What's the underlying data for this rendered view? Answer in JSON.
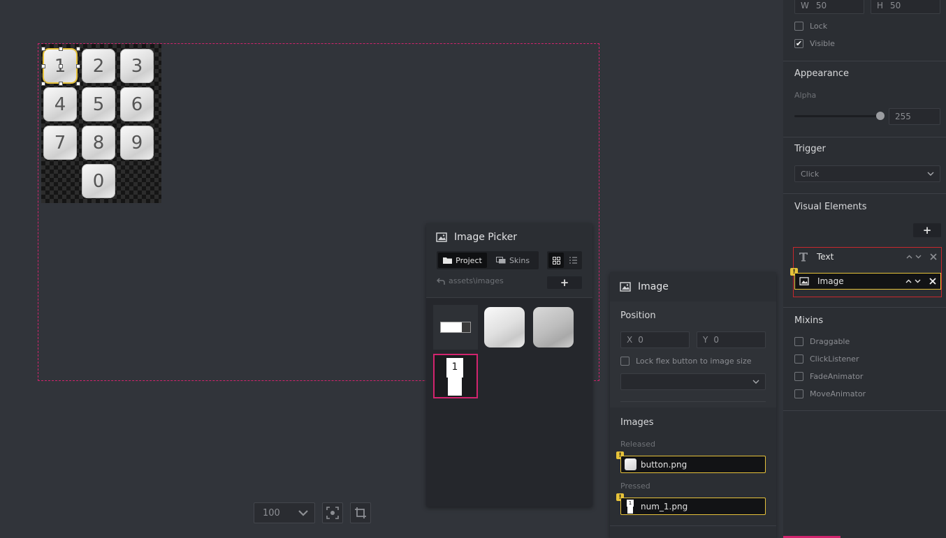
{
  "canvas": {
    "keys": [
      "1",
      "2",
      "3",
      "4",
      "5",
      "6",
      "7",
      "8",
      "9",
      "0"
    ]
  },
  "zoom": {
    "value": "100"
  },
  "image_picker": {
    "title": "Image Picker",
    "tabs": [
      {
        "label": "Project"
      },
      {
        "label": "Skins"
      }
    ],
    "path": "assets\\images",
    "add_label": "+",
    "selected_thumb_text": "1"
  },
  "image_panel": {
    "title": "Image",
    "position_title": "Position",
    "x_label": "X",
    "x_value": "0",
    "y_label": "Y",
    "y_value": "0",
    "lock_label": "Lock flex button to image size",
    "images_title": "Images",
    "released_label": "Released",
    "released_file": "button.png",
    "pressed_label": "Pressed",
    "pressed_file": "num_1.png",
    "pressed_thumb_text": "1"
  },
  "inspector": {
    "w_label": "W",
    "w_value": "50",
    "h_label": "H",
    "h_value": "50",
    "lock_label": "Lock",
    "visible_label": "Visible",
    "appearance_title": "Appearance",
    "alpha_label": "Alpha",
    "alpha_value": "255",
    "alpha_fraction": 1.0,
    "trigger_title": "Trigger",
    "trigger_value": "Click",
    "visual_elements_title": "Visual Elements",
    "add_label": "+",
    "visual_elements": [
      {
        "label": "Text"
      },
      {
        "label": "Image"
      }
    ],
    "mixins_title": "Mixins",
    "mixins": [
      {
        "label": "Draggable"
      },
      {
        "label": "ClickListener"
      },
      {
        "label": "FadeAnimator"
      },
      {
        "label": "MoveAnimator"
      }
    ]
  },
  "colors": {
    "background": "#31343a",
    "panel": "#2b2e33",
    "accent_pink": "#d2246e",
    "warning_yellow": "#e6c23a",
    "error_red": "#c8282d"
  },
  "icons": [
    "image-icon",
    "folder-icon",
    "skins-icon",
    "grid-view-icon",
    "list-view-icon",
    "back-arrow-icon",
    "chevron-down-icon",
    "focus-icon",
    "crop-icon",
    "text-icon",
    "chevron-up-icon",
    "close-icon",
    "warning-icon",
    "check-icon"
  ]
}
